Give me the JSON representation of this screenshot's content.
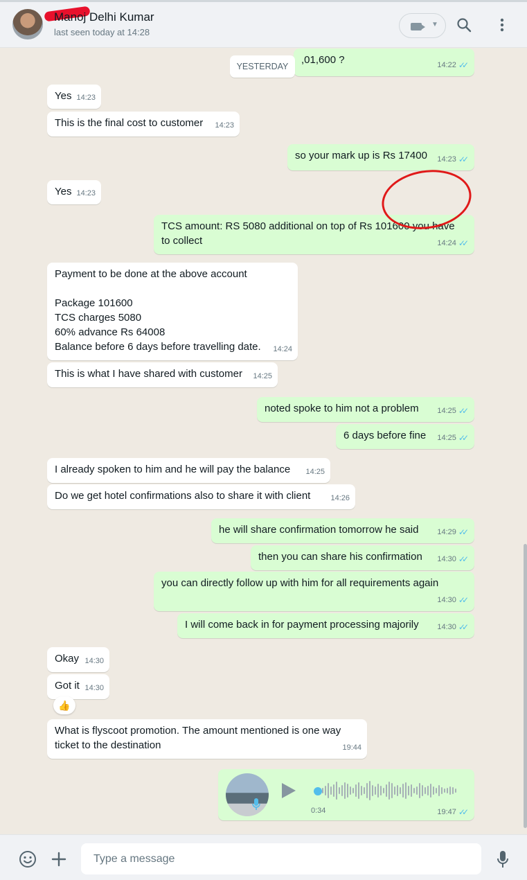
{
  "header": {
    "contact_name": "Manoj Delhi Kumar",
    "status": "last seen today at 14:28",
    "icons": [
      "avatar",
      "video-call-icon",
      "chevron-down-icon",
      "search-icon",
      "menu-dots-icon"
    ]
  },
  "date_chip": "YESTERDAY",
  "messages": [
    {
      "dir": "out",
      "text": ",01,600 ?",
      "time": "14:22"
    },
    {
      "dir": "in",
      "text": "Yes",
      "time": "14:23"
    },
    {
      "dir": "in",
      "text": "This is the final cost to customer",
      "time": "14:23"
    },
    {
      "dir": "out",
      "text": "so your mark up is Rs 17400",
      "time": "14:23"
    },
    {
      "dir": "in",
      "text": "Yes",
      "time": "14:23"
    },
    {
      "dir": "out",
      "text": "TCS amount: RS 5080 additional on top of Rs 101600 you have to collect",
      "time": "14:24"
    },
    {
      "dir": "in",
      "text": "Payment to be done at the above account\n\nPackage 101600\nTCS charges 5080\n60% advance Rs 64008\nBalance before 6 days before travelling date.",
      "time": "14:24"
    },
    {
      "dir": "in",
      "text": "This is what I have shared with customer",
      "time": "14:25"
    },
    {
      "dir": "out",
      "text": "noted spoke to him not a problem",
      "time": "14:25"
    },
    {
      "dir": "out",
      "text": "6 days before fine",
      "time": "14:25"
    },
    {
      "dir": "in",
      "text": "I already spoken to him and he will pay the balance",
      "time": "14:25"
    },
    {
      "dir": "in",
      "text": "Do we get hotel confirmations also to share it with client",
      "time": "14:26"
    },
    {
      "dir": "out",
      "text": "he will share confirmation tomorrow he said",
      "time": "14:29"
    },
    {
      "dir": "out",
      "text": "then you can share his confirmation",
      "time": "14:30"
    },
    {
      "dir": "out",
      "text": "you can directly follow up with him for all requirements again",
      "time": "14:30"
    },
    {
      "dir": "out",
      "text": "I will come back in for payment processing majorily",
      "time": "14:30"
    },
    {
      "dir": "in",
      "text": "Okay",
      "time": "14:30"
    },
    {
      "dir": "in",
      "text": "Got it",
      "time": "14:30"
    },
    {
      "dir": "in",
      "text": "What is flyscoot promotion. The amount mentioned is one way ticket to the destination",
      "time": "19:44"
    }
  ],
  "reaction": "👍",
  "voice_note": {
    "duration": "0:34",
    "time": "19:47"
  },
  "composer": {
    "placeholder": "Type a message"
  },
  "colors": {
    "incoming": "#ffffff",
    "outgoing": "#d9fdd3",
    "background": "#efeae2",
    "read_tick": "#53bdeb",
    "annotation_circle": "#e01919"
  }
}
